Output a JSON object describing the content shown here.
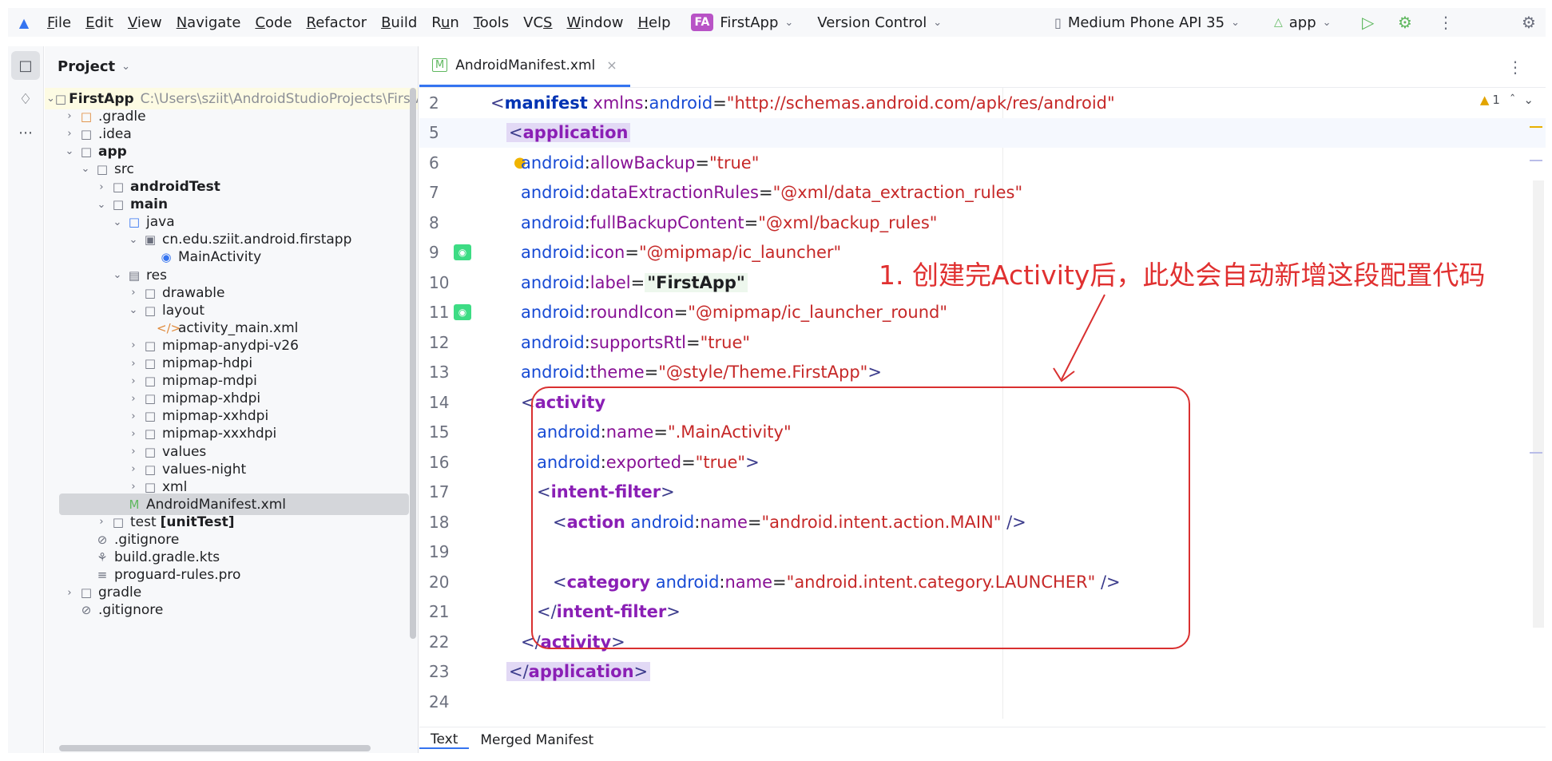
{
  "menubar": {
    "items": [
      {
        "pre": "",
        "u": "F",
        "post": "ile"
      },
      {
        "pre": "",
        "u": "E",
        "post": "dit"
      },
      {
        "pre": "",
        "u": "V",
        "post": "iew"
      },
      {
        "pre": "",
        "u": "N",
        "post": "avigate"
      },
      {
        "pre": "",
        "u": "C",
        "post": "ode"
      },
      {
        "pre": "",
        "u": "R",
        "post": "efactor"
      },
      {
        "pre": "",
        "u": "B",
        "post": "uild"
      },
      {
        "pre": "R",
        "u": "u",
        "post": "n"
      },
      {
        "pre": "",
        "u": "T",
        "post": "ools"
      },
      {
        "pre": "VC",
        "u": "S",
        "post": ""
      },
      {
        "pre": "",
        "u": "W",
        "post": "indow"
      },
      {
        "pre": "",
        "u": "H",
        "post": "elp"
      }
    ],
    "project_badge": "FA",
    "project_name": "FirstApp",
    "vcs": "Version Control",
    "device": "Medium Phone API 35",
    "run_config": "app"
  },
  "project_panel": {
    "title": "Project",
    "root_name": "FirstApp",
    "root_path": "C:\\Users\\sziit\\AndroidStudioProjects\\FirstA",
    "tree": [
      {
        "label": ".gradle",
        "indent": 1,
        "arrow": ">",
        "icon": "folder-orange"
      },
      {
        "label": ".idea",
        "indent": 1,
        "arrow": ">",
        "icon": "folder"
      },
      {
        "label": "app",
        "indent": 1,
        "arrow": "v",
        "icon": "module",
        "bold": true
      },
      {
        "label": "src",
        "indent": 2,
        "arrow": "v",
        "icon": "folder"
      },
      {
        "label": "androidTest",
        "indent": 3,
        "arrow": ">",
        "icon": "module",
        "bold": true
      },
      {
        "label": "main",
        "indent": 3,
        "arrow": "v",
        "icon": "module",
        "bold": true
      },
      {
        "label": "java",
        "indent": 4,
        "arrow": "v",
        "icon": "folder-blue"
      },
      {
        "label": "cn.edu.sziit.android.firstapp",
        "indent": 5,
        "arrow": "v",
        "icon": "package"
      },
      {
        "label": "MainActivity",
        "indent": 6,
        "arrow": "",
        "icon": "activity"
      },
      {
        "label": "res",
        "indent": 4,
        "arrow": "v",
        "icon": "res"
      },
      {
        "label": "drawable",
        "indent": 5,
        "arrow": ">",
        "icon": "folder"
      },
      {
        "label": "layout",
        "indent": 5,
        "arrow": "v",
        "icon": "folder"
      },
      {
        "label": "activity_main.xml",
        "indent": 6,
        "arrow": "",
        "icon": "xml-orange"
      },
      {
        "label": "mipmap-anydpi-v26",
        "indent": 5,
        "arrow": ">",
        "icon": "folder"
      },
      {
        "label": "mipmap-hdpi",
        "indent": 5,
        "arrow": ">",
        "icon": "folder"
      },
      {
        "label": "mipmap-mdpi",
        "indent": 5,
        "arrow": ">",
        "icon": "folder"
      },
      {
        "label": "mipmap-xhdpi",
        "indent": 5,
        "arrow": ">",
        "icon": "folder"
      },
      {
        "label": "mipmap-xxhdpi",
        "indent": 5,
        "arrow": ">",
        "icon": "folder"
      },
      {
        "label": "mipmap-xxxhdpi",
        "indent": 5,
        "arrow": ">",
        "icon": "folder"
      },
      {
        "label": "values",
        "indent": 5,
        "arrow": ">",
        "icon": "folder"
      },
      {
        "label": "values-night",
        "indent": 5,
        "arrow": ">",
        "icon": "folder"
      },
      {
        "label": "xml",
        "indent": 5,
        "arrow": ">",
        "icon": "folder"
      },
      {
        "label": "AndroidManifest.xml",
        "indent": 4,
        "arrow": "",
        "icon": "manifest",
        "selected": true
      },
      {
        "label": "test",
        "suffix": "[unitTest]",
        "indent": 3,
        "arrow": ">",
        "icon": "module"
      },
      {
        "label": ".gitignore",
        "indent": 2,
        "arrow": "",
        "icon": "ignore"
      },
      {
        "label": "build.gradle.kts",
        "indent": 2,
        "arrow": "",
        "icon": "gradle"
      },
      {
        "label": "proguard-rules.pro",
        "indent": 2,
        "arrow": "",
        "icon": "text"
      },
      {
        "label": "gradle",
        "indent": 1,
        "arrow": ">",
        "icon": "folder"
      },
      {
        "label": ".gitignore",
        "indent": 1,
        "arrow": "",
        "icon": "ignore"
      }
    ]
  },
  "editor": {
    "tab_label": "AndroidManifest.xml",
    "inspection_count": "1",
    "lines": [
      {
        "n": "2",
        "html": "<span class='b'>&lt;</span><span class='tag'>manifest</span> <span class='ns'>xmlns</span><span class='eq'>:</span><span class='attr'>android</span><span class='eq'>=</span><span class='val'>\"http://schemas.android.com/apk/res/android\"</span>",
        "indent": 90
      },
      {
        "n": "5",
        "html": "<span class='hl-tag'><span class='b'>&lt;</span><span class='tagp'>application</span></span>",
        "indent": 110,
        "caret": true
      },
      {
        "n": "6",
        "html": "<span class='attr'>android</span><span class='eq'>:</span><span class='ns'>allowBackup</span><span class='eq'>=</span><span class='val'>\"true\"</span>",
        "indent": 128,
        "bulb": true
      },
      {
        "n": "7",
        "html": "<span class='attr'>android</span><span class='eq'>:</span><span class='ns'>dataExtractionRules</span><span class='eq'>=</span><span class='val'>\"@xml/data_extraction_rules\"</span>",
        "indent": 128
      },
      {
        "n": "8",
        "html": "<span class='attr'>android</span><span class='eq'>:</span><span class='ns'>fullBackupContent</span><span class='eq'>=</span><span class='val'>\"@xml/backup_rules\"</span>",
        "indent": 128
      },
      {
        "n": "9",
        "html": "<span class='attr'>android</span><span class='eq'>:</span><span class='ns'>icon</span><span class='eq'>=</span><span class='val'>\"@mipmap/ic_launcher\"</span>",
        "indent": 128,
        "android": true
      },
      {
        "n": "10",
        "html": "<span class='attr'>android</span><span class='eq'>:</span><span class='ns'>label</span><span class='eq'>=</span><span class='hl-label'>\"FirstApp\"</span>",
        "indent": 128
      },
      {
        "n": "11",
        "html": "<span class='attr'>android</span><span class='eq'>:</span><span class='ns'>roundIcon</span><span class='eq'>=</span><span class='val'>\"@mipmap/ic_launcher_round\"</span>",
        "indent": 128,
        "android": true
      },
      {
        "n": "12",
        "html": "<span class='attr'>android</span><span class='eq'>:</span><span class='ns'>supportsRtl</span><span class='eq'>=</span><span class='val'>\"true\"</span>",
        "indent": 128
      },
      {
        "n": "13",
        "html": "<span class='attr'>android</span><span class='eq'>:</span><span class='ns'>theme</span><span class='eq'>=</span><span class='val'>\"@style/Theme.FirstApp\"</span><span class='b'>&gt;</span>",
        "indent": 128
      },
      {
        "n": "14",
        "html": "<span class='b'>&lt;</span><span class='tagp'>activity</span>",
        "indent": 128
      },
      {
        "n": "15",
        "html": "<span class='attr'>android</span><span class='eq'>:</span><span class='ns'>name</span><span class='eq'>=</span><span class='val'>\".MainActivity\"</span>",
        "indent": 148
      },
      {
        "n": "16",
        "html": "<span class='attr'>android</span><span class='eq'>:</span><span class='ns'>exported</span><span class='eq'>=</span><span class='val'>\"true\"</span><span class='b'>&gt;</span>",
        "indent": 148
      },
      {
        "n": "17",
        "html": "<span class='b'>&lt;</span><span class='tagp'>intent-filter</span><span class='b'>&gt;</span>",
        "indent": 148
      },
      {
        "n": "18",
        "html": "<span class='b'>&lt;</span><span class='tagp'>action</span> <span class='attr'>android</span><span class='eq'>:</span><span class='ns'>name</span><span class='eq'>=</span><span class='val'>\"android.intent.action.MAIN\"</span> <span class='b'>/&gt;</span>",
        "indent": 168
      },
      {
        "n": "19",
        "html": "",
        "indent": 168
      },
      {
        "n": "20",
        "html": "<span class='b'>&lt;</span><span class='tagp'>category</span> <span class='attr'>android</span><span class='eq'>:</span><span class='ns'>name</span><span class='eq'>=</span><span class='val'>\"android.intent.category.LAUNCHER\"</span> <span class='b'>/&gt;</span>",
        "indent": 168
      },
      {
        "n": "21",
        "html": "<span class='b'>&lt;/</span><span class='tagp'>intent-filter</span><span class='b'>&gt;</span>",
        "indent": 148
      },
      {
        "n": "22",
        "html": "<span class='b'>&lt;/</span><span class='tagp'>activity</span><span class='b'>&gt;</span>",
        "indent": 128
      },
      {
        "n": "23",
        "html": "<span class='hl-tag'><span class='b'>&lt;/</span><span class='tagp'>application</span><span class='b'>&gt;</span></span>",
        "indent": 110
      },
      {
        "n": "24",
        "html": "",
        "indent": 110
      }
    ],
    "annotation": "1. 创建完Activity后，此处会自动新增这段配置代码",
    "bottom_tabs": [
      "Text",
      "Merged Manifest"
    ]
  }
}
